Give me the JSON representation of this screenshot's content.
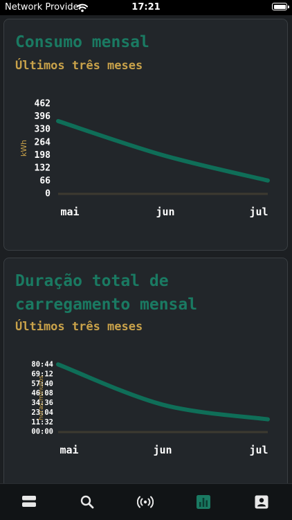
{
  "status_bar": {
    "carrier": "Network Provider",
    "time": "17:21"
  },
  "colors": {
    "accent_green": "#1a7a62",
    "accent_gold": "#c9a24a",
    "card_bg": "#22262a",
    "line": "#0f6e58"
  },
  "cards": [
    {
      "title": "Consumo mensal",
      "subtitle": "Últimos três meses",
      "chart_data": {
        "type": "line",
        "categories": [
          "mai",
          "jun",
          "jul"
        ],
        "values": [
          370,
          195,
          65
        ],
        "ylabel": "kWh",
        "ylim": [
          0,
          462
        ],
        "yticks": [
          "462",
          "396",
          "330",
          "264",
          "198",
          "132",
          "66",
          "0"
        ],
        "grid": false
      }
    },
    {
      "title": "Duração total de carregamento mensal",
      "subtitle": "Últimos três meses",
      "chart_data": {
        "type": "line",
        "categories": [
          "mai",
          "jun",
          "jul"
        ],
        "values": [
          80.5,
          32,
          14.5
        ],
        "ylabel": "horas:minutos",
        "ylim": [
          0,
          80.733
        ],
        "yticks": [
          "80:44",
          "69:12",
          "57:40",
          "46:08",
          "34:36",
          "23:04",
          "11:32",
          "00:00"
        ],
        "grid": false
      }
    }
  ],
  "tab_bar": {
    "items": [
      {
        "icon": "list-icon",
        "active": false
      },
      {
        "icon": "search-icon",
        "active": false
      },
      {
        "icon": "broadcast-icon",
        "active": false
      },
      {
        "icon": "bar-chart-icon",
        "active": true
      },
      {
        "icon": "profile-icon",
        "active": false
      }
    ]
  }
}
